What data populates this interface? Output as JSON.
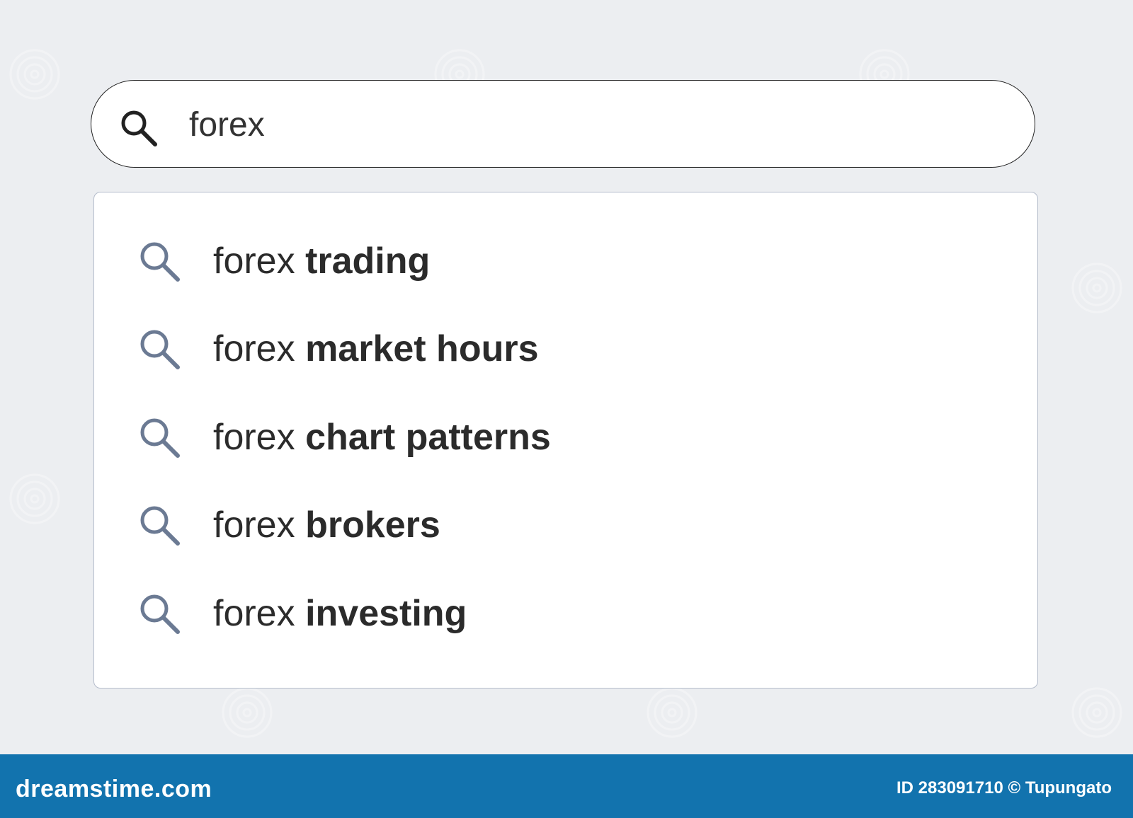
{
  "search": {
    "query": "forex",
    "icon": "search-icon"
  },
  "suggestions": [
    {
      "base": "forex ",
      "completion": "trading",
      "icon": "search-icon"
    },
    {
      "base": "forex ",
      "completion": "market hours",
      "icon": "search-icon"
    },
    {
      "base": "forex ",
      "completion": "chart patterns",
      "icon": "search-icon"
    },
    {
      "base": "forex ",
      "completion": "brokers",
      "icon": "search-icon"
    },
    {
      "base": "forex ",
      "completion": "investing",
      "icon": "search-icon"
    }
  ],
  "footer": {
    "brand": "dreamstime.com",
    "credit": "ID 283091710 © Tupungato"
  },
  "colors": {
    "page_background": "#eceef1",
    "search_border": "#222222",
    "dropdown_border": "#b4bccb",
    "suggestion_icon": "#6b7a93",
    "footer_background": "#1273ae"
  }
}
